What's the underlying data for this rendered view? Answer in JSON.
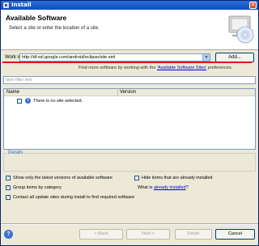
{
  "window": {
    "title": "Install",
    "close_glyph": "✕"
  },
  "header": {
    "title": "Available Software",
    "subtitle": "Select a site or enter the location of a site."
  },
  "work_with": {
    "label": "Work with:",
    "value": "http://dl-ssl.google.com/android/eclipse/site.xml",
    "add_label": "Add..."
  },
  "find_more": {
    "prefix": "Find more software by working with the ",
    "link": "'Available Software Sites'",
    "suffix": " preferences."
  },
  "filter": {
    "placeholder": "type filter text"
  },
  "tree": {
    "columns": [
      "Name",
      "Version"
    ],
    "rows": [
      {
        "text": "There is no site selected."
      }
    ]
  },
  "details": {
    "label": "Details"
  },
  "options": {
    "show_latest": "Show only the latest versions of available software",
    "hide_installed": "Hide items that are already installed",
    "group_by_category": "Group items by category",
    "what_is_prefix": "What is ",
    "what_is_link": "already installed",
    "what_is_suffix": "?",
    "contact_sites": "Contact all update sites during install to find required software",
    "check_glyph": "✓"
  },
  "footer": {
    "help_glyph": "?",
    "back": "< Back",
    "next": "Next >",
    "finish": "Finish",
    "cancel": "Cancel"
  }
}
